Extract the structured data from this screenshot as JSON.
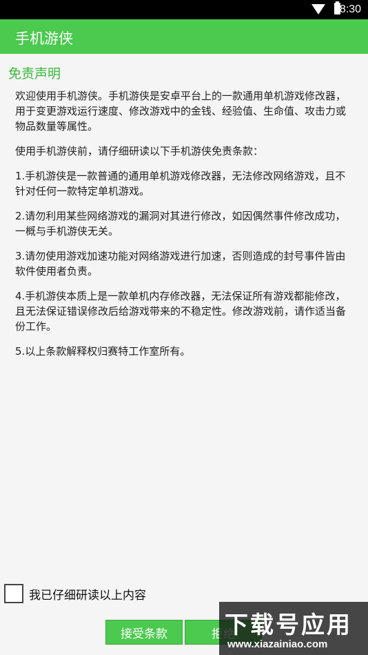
{
  "status_bar": {
    "time": "8:30",
    "icons": [
      "wifi-icon",
      "battery-icon"
    ]
  },
  "app_bar": {
    "title": "手机游侠"
  },
  "section": {
    "title": "免责声明"
  },
  "paragraphs": [
    "欢迎使用手机游侠。手机游侠是安卓平台上的一款通用单机游戏修改器，用于变更游戏运行速度、修改游戏中的金钱、经验值、生命值、攻击力或物品数量等属性。",
    "使用手机游侠前，请仔细研读以下手机游侠免责条款：",
    "1.手机游侠是一款普通的通用单机游戏修改器，无法修改网络游戏，且不针对任何一款特定单机游戏。",
    "2.请勿利用某些网络游戏的漏洞对其进行修改，如因偶然事件修改成功，一概与手机游侠无关。",
    "3.请勿使用游戏加速功能对网络游戏进行加速，否则造成的封号事件皆由软件使用者负责。",
    "4.手机游侠本质上是一款单机内存修改器，无法保证所有游戏都能修改，且无法保证错误修改后给游戏带来的不稳定性。修改游戏前，请作适当备份工作。",
    "5.以上条款解释权归赛特工作室所有。"
  ],
  "agreement": {
    "checkbox_label": "我已仔细研读以上内容",
    "checked": false
  },
  "buttons": {
    "accept": "接受条款",
    "reject": "拒绝"
  },
  "watermark": {
    "title": "下载号应用",
    "url": "www.xiazainiao.com"
  },
  "colors": {
    "accent": "#4cc94f",
    "section_title": "#39b83c",
    "status_bar": "#000000",
    "background": "#f5f5f5"
  }
}
